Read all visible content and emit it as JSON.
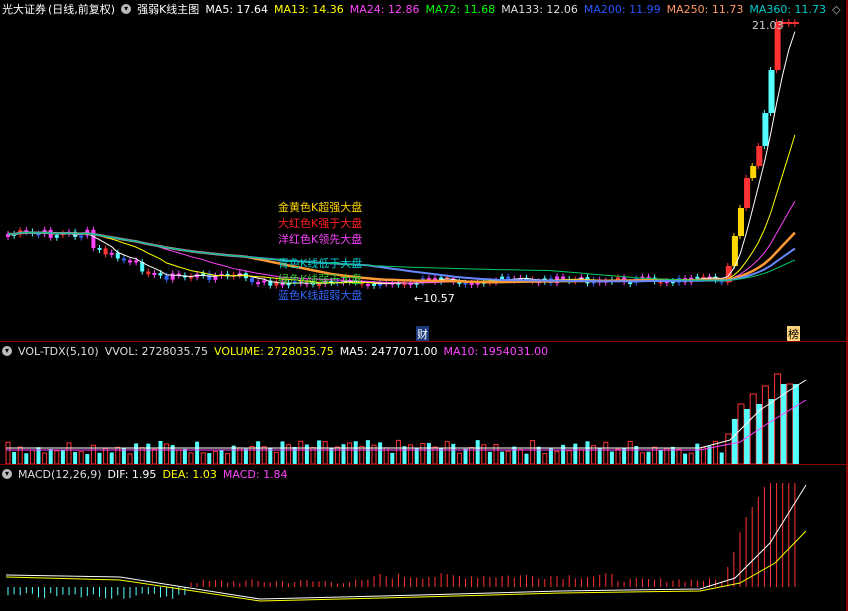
{
  "main_header": {
    "stock_name": "光大证券",
    "period": "(日线,前复权)",
    "indicator": "强弱K线主图",
    "ma": [
      {
        "label": "MA5: 17.64",
        "color": "#ffffff"
      },
      {
        "label": "MA13: 14.36",
        "color": "#ffff00"
      },
      {
        "label": "MA24: 12.86",
        "color": "#ff44ff"
      },
      {
        "label": "MA72: 11.68",
        "color": "#00ff00"
      },
      {
        "label": "MA133: 12.06",
        "color": "#dddddd"
      },
      {
        "label": "MA200: 11.99",
        "color": "#2a55ff"
      },
      {
        "label": "MA250: 11.73",
        "color": "#ff9966"
      },
      {
        "label": "MA360: 11.73",
        "color": "#00cccc"
      }
    ],
    "expand_icon": "diamond-icon"
  },
  "annotations": {
    "high_price": "21.03",
    "low_price": "10.57",
    "finance_tag": "财",
    "rank_tag": "榜"
  },
  "legend": [
    {
      "text": "金黄色K超强大盘",
      "color": "#ffd700"
    },
    {
      "text": "大红色K强于大盘",
      "color": "#ff2020"
    },
    {
      "text": "洋红色K领先大盘",
      "color": "#ff44ff"
    },
    {
      "text": "青色K线低于大盘",
      "color": "#00cccc"
    },
    {
      "text": "绿色K线弱于大盘",
      "color": "#33cc33"
    },
    {
      "text": "蓝色K线超弱大盘",
      "color": "#3366ff"
    }
  ],
  "vol_header": {
    "name": "VOL-TDX(5,10)",
    "vvol": "VVOL: 2728035.75",
    "volume": "VOLUME: 2728035.75",
    "ma5": "MA5: 2477071.00",
    "ma10": "MA10: 1954031.00"
  },
  "macd_header": {
    "name": "MACD(12,26,9)",
    "dif": "DIF: 1.95",
    "dea": "DEA: 1.03",
    "macd": "MACD: 1.84"
  },
  "colors": {
    "up_candle": "#ff3333",
    "down_candle": "#54ffff",
    "gold_candle": "#ffd700",
    "magenta_candle": "#ff44ff",
    "blue_candle": "#3366ff",
    "separator": "#8b0000"
  }
}
